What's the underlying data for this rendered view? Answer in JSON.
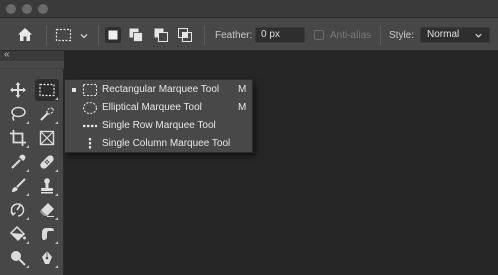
{
  "options_bar": {
    "feather_label": "Feather:",
    "feather_value": "0 px",
    "anti_alias_label": "Anti-alias",
    "style_label": "Style:",
    "style_value": "Normal"
  },
  "toolbar": {
    "collapse_glyph": "«",
    "tools": [
      {
        "id": "move",
        "icon": "move-icon"
      },
      {
        "id": "rect-marquee",
        "icon": "rectangular-marquee-icon",
        "selected": true
      },
      {
        "id": "lasso",
        "icon": "lasso-icon"
      },
      {
        "id": "quick-select",
        "icon": "quick-selection-icon"
      },
      {
        "id": "crop",
        "icon": "crop-icon"
      },
      {
        "id": "frame",
        "icon": "frame-icon"
      },
      {
        "id": "eyedropper",
        "icon": "eyedropper-icon"
      },
      {
        "id": "healing",
        "icon": "healing-brush-icon"
      },
      {
        "id": "brush",
        "icon": "brush-icon"
      },
      {
        "id": "clone-stamp",
        "icon": "clone-stamp-icon"
      },
      {
        "id": "history-brush",
        "icon": "history-brush-icon"
      },
      {
        "id": "eraser",
        "icon": "eraser-icon"
      },
      {
        "id": "paint-bucket",
        "icon": "paint-bucket-icon"
      },
      {
        "id": "smudge",
        "icon": "smudge-icon"
      },
      {
        "id": "dodge",
        "icon": "dodge-icon"
      },
      {
        "id": "pen",
        "icon": "pen-icon"
      }
    ]
  },
  "flyout": {
    "items": [
      {
        "label": "Rectangular Marquee Tool",
        "shortcut": "M",
        "active": true,
        "icon": "rectangular-marquee-icon"
      },
      {
        "label": "Elliptical Marquee Tool",
        "shortcut": "M",
        "active": false,
        "icon": "elliptical-marquee-icon"
      },
      {
        "label": "Single Row Marquee Tool",
        "shortcut": "",
        "active": false,
        "icon": "single-row-marquee-icon"
      },
      {
        "label": "Single Column Marquee Tool",
        "shortcut": "",
        "active": false,
        "icon": "single-column-marquee-icon"
      }
    ]
  }
}
